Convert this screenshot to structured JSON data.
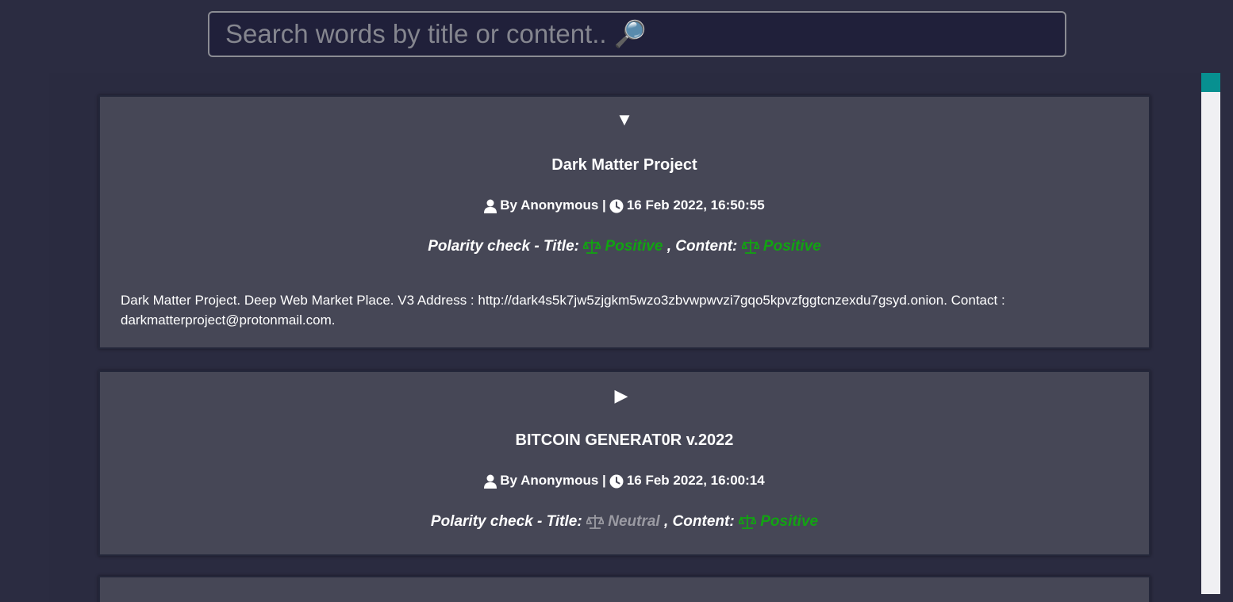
{
  "search": {
    "placeholder": "Search words by title or content.. 🔎"
  },
  "posts": [
    {
      "toggle": "▼",
      "title": "Dark Matter Project",
      "by_label": "By Anonymous |",
      "timestamp": "16 Feb 2022, 16:50:55",
      "polarity_label": "Polarity check - Title:",
      "title_polarity": "Positive",
      "content_label": ", Content:",
      "content_polarity": "Positive",
      "content": "Dark Matter Project. Deep Web Market Place. V3 Address : http://dark4s5k7jw5zjgkm5wzo3zbvwpwvzi7gqo5kpvzfggtcnzexdu7gsyd.onion. Contact : darkmatterproject@protonmail.com."
    },
    {
      "toggle": "▶",
      "title": "BITCOIN GENERAT0R v.2022",
      "by_label": "By Anonymous |",
      "timestamp": "16 Feb 2022, 16:00:14",
      "polarity_label": "Polarity check - Title:",
      "title_polarity": "Neutral",
      "content_label": ", Content:",
      "content_polarity": "Positive"
    }
  ],
  "colors": {
    "positive": "#12a312",
    "neutral": "#9a9aa2",
    "accent": "#079090",
    "card_bg": "#464756",
    "page_bg": "#2b2c41"
  },
  "icons": {
    "user": "user-icon",
    "clock": "clock-icon",
    "scale": "scale-icon"
  }
}
